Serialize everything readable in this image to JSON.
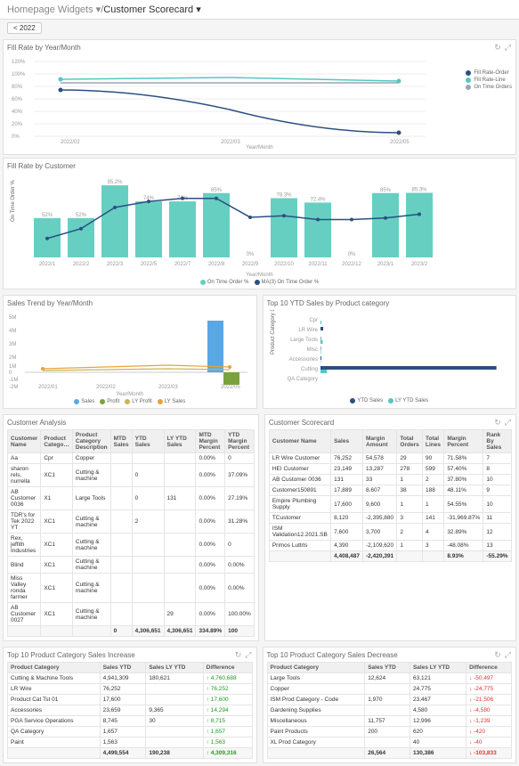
{
  "breadcrumb": {
    "root": "Homepage Widgets",
    "sep": " / ",
    "current": "Customer Scorecard",
    "dropdown_icon": "▾"
  },
  "filter_chip": "< 2022",
  "cards": {
    "fill_year": {
      "title": "Fill Rate by Year/Month",
      "xlabel": "Year/Month",
      "legend": [
        "Fill Rate-Order",
        "Fill Rate-Line",
        "On Time Orders"
      ]
    },
    "fill_cust": {
      "title": "Fill Rate by Customer",
      "xlabel": "Year/Month",
      "ylabel_left": "On Time Order %",
      "ylabel_right": "MA(3) On Time Order %",
      "legend": [
        "On Time Order %",
        "MA(3) On Time Order %"
      ]
    },
    "sales_trend": {
      "title": "Sales Trend by Year/Month",
      "xlabel": "Year/Month",
      "legend": [
        "Sales",
        "Profit",
        "LY Profit",
        "LY Sales"
      ]
    },
    "top10_ytd": {
      "title": "Top 10 YTD Sales by Product category",
      "ylabel": "Product Category Description",
      "legend": [
        "YTD Sales",
        "LY YTD Sales"
      ]
    },
    "cust_analysis": {
      "title": "Customer Analysis",
      "headers": [
        "Customer Name",
        "Product Catego…",
        "Product Category Description",
        "MTD Sales",
        "YTD Sales",
        "LY YTD Sales",
        "MTD Margin Percent",
        "YTD Margin Percent"
      ],
      "rows": [
        [
          "Aa",
          "Cpr",
          "Copper",
          "",
          "",
          "",
          "0.00%",
          "0"
        ],
        [
          "sharon rels, nurrella",
          "XC1",
          "Cutting & machine",
          "",
          "0",
          "",
          "0.00%",
          "37.09%"
        ],
        [
          "AB Customer 0036",
          "X1",
          "Large Tools",
          "",
          "0",
          "131",
          "0.00%",
          "27.19%"
        ],
        [
          "TDR's for Tek 2022 YT",
          "XC1",
          "Cutting & machine",
          "",
          "2",
          "",
          "0.00%",
          "31.28%"
        ],
        [
          "Rex, jeffith Industries",
          "XC1",
          "Cutting & machine",
          "",
          "",
          "",
          "0.00%",
          "0"
        ],
        [
          "Blind",
          "XC1",
          "Cutting & machine",
          "",
          "",
          "",
          "0.00%",
          "0.00%"
        ],
        [
          "Miss Valley ronda farmer",
          "XC1",
          "Cutting & machine",
          "",
          "",
          "",
          "0.00%",
          "0.00%"
        ],
        [
          "AB Customer 0027",
          "XC1",
          "Cutting & machine",
          "",
          "",
          "29",
          "0.00%",
          "100.00%"
        ]
      ],
      "totals": [
        "",
        "",
        "",
        "0",
        "4,306,651",
        "4,306,651",
        "334.89%",
        "100"
      ]
    },
    "scorecard": {
      "title": "Customer Scorecard",
      "headers": [
        "Customer Name",
        "Sales",
        "Margin Amount",
        "Total Orders",
        "Total Lines",
        "Margin Percent",
        "Rank By Sales"
      ],
      "rows": [
        [
          "LR Wire Customer",
          "76,252",
          "54,578",
          "29",
          "90",
          "71.58%",
          "7"
        ],
        [
          "HEI Customer",
          "23,149",
          "13,287",
          "278",
          "599",
          "57.40%",
          "8"
        ],
        [
          "AB Customer 0036",
          "131",
          "33",
          "1",
          "2",
          "37.80%",
          "10"
        ],
        [
          "Customer150891",
          "17,889",
          "8,607",
          "38",
          "188",
          "48.11%",
          "9"
        ],
        [
          "Empire Plumbing Supply",
          "17,600",
          "9,600",
          "1",
          "1",
          "54.55%",
          "10"
        ],
        [
          "TCustomer",
          "8,120",
          "-2,395,880",
          "3",
          "141",
          "-31,969.87%",
          "11"
        ],
        [
          "ISM Validation12.2021.SB",
          "7,600",
          "3,700",
          "2",
          "4",
          "32.89%",
          "12"
        ],
        [
          "Primos Luttrls",
          "4,390",
          "-2,109,620",
          "1",
          "3",
          "-48.08%",
          "13"
        ]
      ],
      "totals": [
        "",
        "4,408,487",
        "-2,420,391",
        "",
        "",
        "8.93%",
        "-55.29%"
      ]
    },
    "inc": {
      "title": "Top 10 Product Category Sales Increase",
      "headers": [
        "Product Category",
        "Sales YTD",
        "Sales LY YTD",
        "Difference"
      ],
      "rows": [
        [
          "Cutting & Machine Tools",
          "4,941,309",
          "180,621",
          "4,760,688"
        ],
        [
          "LR Wire",
          "76,252",
          "",
          "76,252"
        ],
        [
          "Product Cat Tst 01",
          "17,600",
          "",
          "17,600"
        ],
        [
          "Accessories",
          "23,659",
          "9,365",
          "14,294"
        ],
        [
          "PGA Service Operations",
          "8,745",
          "30",
          "8,715"
        ],
        [
          "QA Category",
          "1,657",
          "",
          "1,657"
        ],
        [
          "Paint",
          "1,563",
          "",
          "1,563"
        ]
      ],
      "totals": [
        "",
        "4,499,554",
        "190,238",
        "4,309,316"
      ]
    },
    "dec": {
      "title": "Top 10 Product Category Sales Decrease",
      "headers": [
        "Product Category",
        "Sales YTD",
        "Sales LY YTD",
        "Difference"
      ],
      "rows": [
        [
          "Large Tools",
          "12,624",
          "63,121",
          "-50,497"
        ],
        [
          "Copper",
          "",
          "24,775",
          "-24,775"
        ],
        [
          "ISM Prod Category - Code",
          "1,970",
          "23,467",
          "-21,506"
        ],
        [
          "Gardening Supplies",
          "",
          "4,580",
          "-4,580"
        ],
        [
          "Miscellaneous",
          "11,757",
          "12,996",
          "-1,239"
        ],
        [
          "Paint Products",
          "200",
          "620",
          "-420"
        ],
        [
          "XL Prod Category",
          "",
          "40",
          "-40"
        ]
      ],
      "totals": [
        "",
        "26,564",
        "130,386",
        "-103,833"
      ]
    }
  },
  "chart_data": {
    "fill_year": {
      "type": "line",
      "x": [
        "2022/02",
        "2022/03",
        "2022/05"
      ],
      "series": [
        {
          "name": "Fill Rate-Order",
          "color": "#2b4f81",
          "values": [
            70,
            35,
            10
          ]
        },
        {
          "name": "Fill Rate-Line",
          "color": "#54c7c4",
          "values": [
            90,
            92,
            88
          ]
        },
        {
          "name": "On Time Orders",
          "color": "#9aa7b3",
          "values": [
            85,
            85,
            85
          ]
        }
      ],
      "ylim": [
        0,
        120
      ],
      "yticks": [
        0,
        20,
        40,
        60,
        80,
        100,
        120
      ]
    },
    "fill_cust": {
      "type": "bar+line",
      "categories": [
        "2022/1",
        "2022/2",
        "2022/3",
        "2022/5",
        "2022/7",
        "2022/8",
        "2022/9",
        "2022/10",
        "2022/11",
        "2022/12",
        "2023/1",
        "2023/2"
      ],
      "bars": {
        "name": "On Time Order %",
        "color": "#66cfc2",
        "values": [
          52,
          52,
          95.2,
          74,
          74,
          85,
          0,
          78.3,
          72.4,
          0,
          85,
          85.3
        ]
      },
      "line": {
        "name": "MA(3) On Time Order %",
        "color": "#2b4f81",
        "values": [
          25,
          38,
          66,
          74,
          78,
          78,
          53,
          55,
          50,
          50,
          52,
          57
        ]
      },
      "ylim": [
        0,
        100
      ]
    },
    "sales_trend": {
      "type": "bar+line",
      "x": [
        "2022/01",
        "2022/02",
        "2022/03",
        "2022/05"
      ],
      "bars": [
        {
          "name": "Sales",
          "color": "#5aa7e6",
          "values": [
            0,
            0,
            0.05,
            5.0
          ]
        },
        {
          "name": "Profit",
          "color": "#7aa23c",
          "values": [
            0,
            0,
            0,
            -1.0
          ]
        }
      ],
      "lines": [
        {
          "name": "LY Sales",
          "color": "#e8a23c",
          "values": [
            0.2,
            0.25,
            0.3,
            0.25
          ]
        },
        {
          "name": "LY Profit",
          "color": "#c9b45a",
          "values": [
            0.1,
            0.15,
            0.2,
            0.15
          ]
        }
      ],
      "ylim": [
        -2,
        5.5
      ]
    },
    "top10_ytd": {
      "type": "bar-horizontal",
      "categories": [
        "Cpr",
        "LR Wire",
        "Large Tools",
        "Misc",
        "Accessories",
        "Cutting",
        "QA Category"
      ],
      "series": [
        {
          "name": "YTD Sales",
          "color": "#2b4f81",
          "values": [
            0,
            76,
            13,
            12,
            24,
            4941,
            2
          ]
        },
        {
          "name": "LY YTD Sales",
          "color": "#54c7c4",
          "values": [
            25,
            0,
            63,
            13,
            9,
            181,
            0
          ]
        }
      ]
    }
  },
  "colors": {
    "teal": "#66cfc2",
    "blue": "#2b4f81",
    "lblue": "#5aa7e6",
    "cyan": "#54c7c4",
    "green": "#7aa23c",
    "orange": "#e8a23c"
  }
}
